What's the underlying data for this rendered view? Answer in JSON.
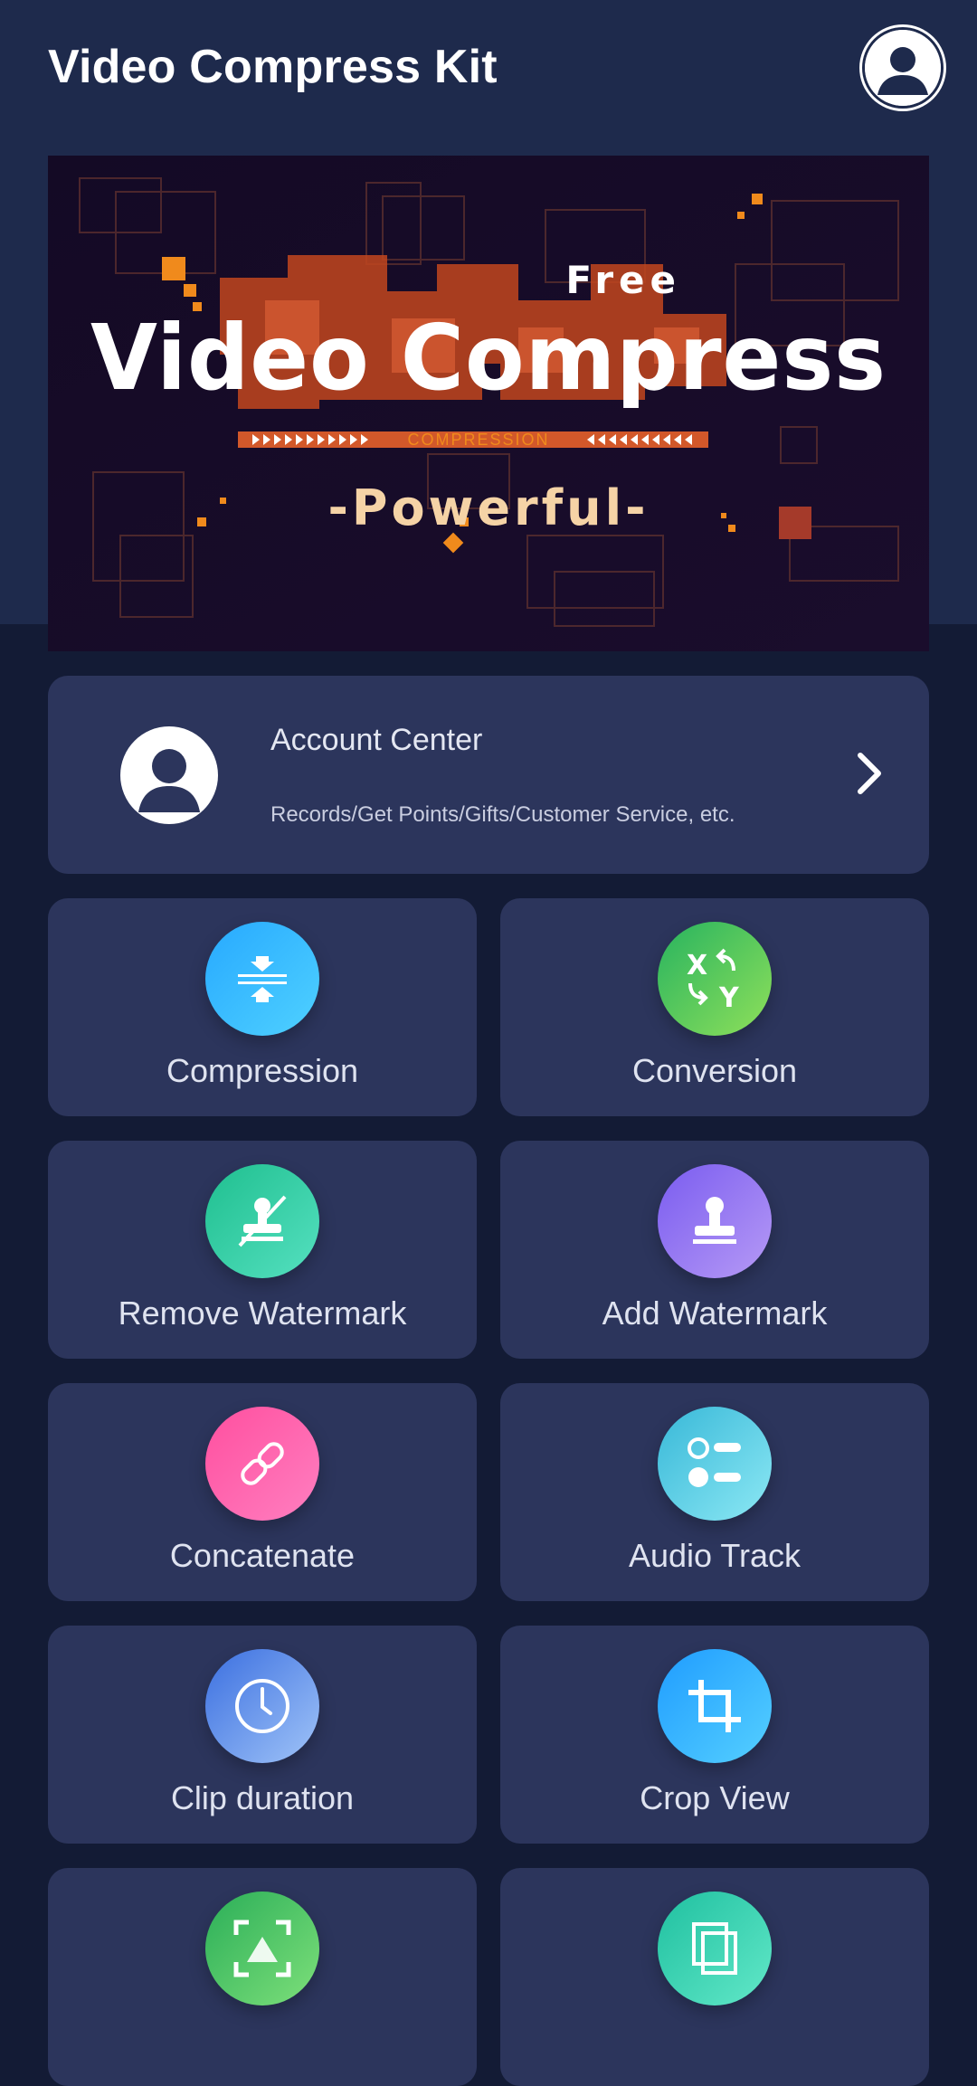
{
  "header": {
    "title": "Video Compress Kit",
    "profile_icon": "user-avatar-icon"
  },
  "banner": {
    "free": "Free",
    "headline": "Video Compress",
    "compression": "COMPRESSION",
    "tagline": "-Powerful-"
  },
  "account": {
    "title": "Account Center",
    "subtitle": "Records/Get Points/Gifts/Customer Service, etc.",
    "icon": "user-avatar-icon",
    "chevron": "chevron-right-icon"
  },
  "features": [
    {
      "label": "Compression",
      "icon": "compress-icon",
      "colors": [
        "#27a9ff",
        "#4fd1ff"
      ]
    },
    {
      "label": "Conversion",
      "icon": "convert-icon",
      "colors": [
        "#27b35f",
        "#8fe05a"
      ]
    },
    {
      "label": "Remove Watermark",
      "icon": "remove-watermark-icon",
      "colors": [
        "#1fbf8f",
        "#55e0c0"
      ]
    },
    {
      "label": "Add Watermark",
      "icon": "stamp-icon",
      "colors": [
        "#7a5cf0",
        "#b69af5"
      ]
    },
    {
      "label": "Concatenate",
      "icon": "link-icon",
      "colors": [
        "#ff4f9f",
        "#ff7fc0"
      ]
    },
    {
      "label": "Audio Track",
      "icon": "audio-track-icon",
      "colors": [
        "#38b8d8",
        "#8ce8f4"
      ]
    },
    {
      "label": "Clip duration",
      "icon": "clock-icon",
      "colors": [
        "#3b6fe0",
        "#a0c4f8"
      ]
    },
    {
      "label": "Crop View",
      "icon": "crop-icon",
      "colors": [
        "#1f9cff",
        "#55d0ff"
      ]
    },
    {
      "label": "",
      "icon": "scan-frame-icon",
      "colors": [
        "#2aae58",
        "#7ee07a"
      ]
    },
    {
      "label": "",
      "icon": "copy-layers-icon",
      "colors": [
        "#1fc0a0",
        "#62e8c8"
      ]
    }
  ]
}
